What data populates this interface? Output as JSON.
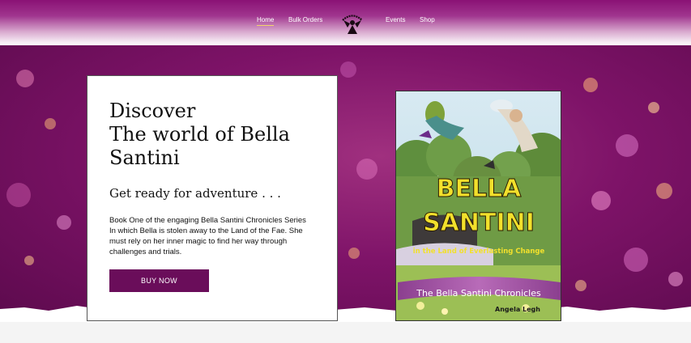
{
  "nav": {
    "items": [
      {
        "label": "Home",
        "active": true
      },
      {
        "label": "Bulk Orders"
      },
      {
        "label": "Events"
      },
      {
        "label": "Shop"
      }
    ],
    "logo_icon": "fairy-logo-icon"
  },
  "colors": {
    "brand_purple": "#6a0d5a",
    "hero_purple": "#7e1368",
    "nav_underline": "#f2d36b"
  },
  "hero": {
    "title_line1": "Discover",
    "title_line2": "The world of Bella Santini",
    "subtitle": "Get ready for adventure . . .",
    "description": "Book One of the engaging Bella Santini Chronicles Series In which Bella is stolen away to the Land of the Fae. She must rely on her inner magic to find her way through challenges and trials.",
    "buy_label": "BUY NOW"
  },
  "book_cover": {
    "title_line1": "BELLA",
    "title_line2": "SANTINI",
    "tagline": "in the Land of Everlasting Change",
    "series": "The Bella Santini Chronicles",
    "author": "Angela Legh"
  }
}
